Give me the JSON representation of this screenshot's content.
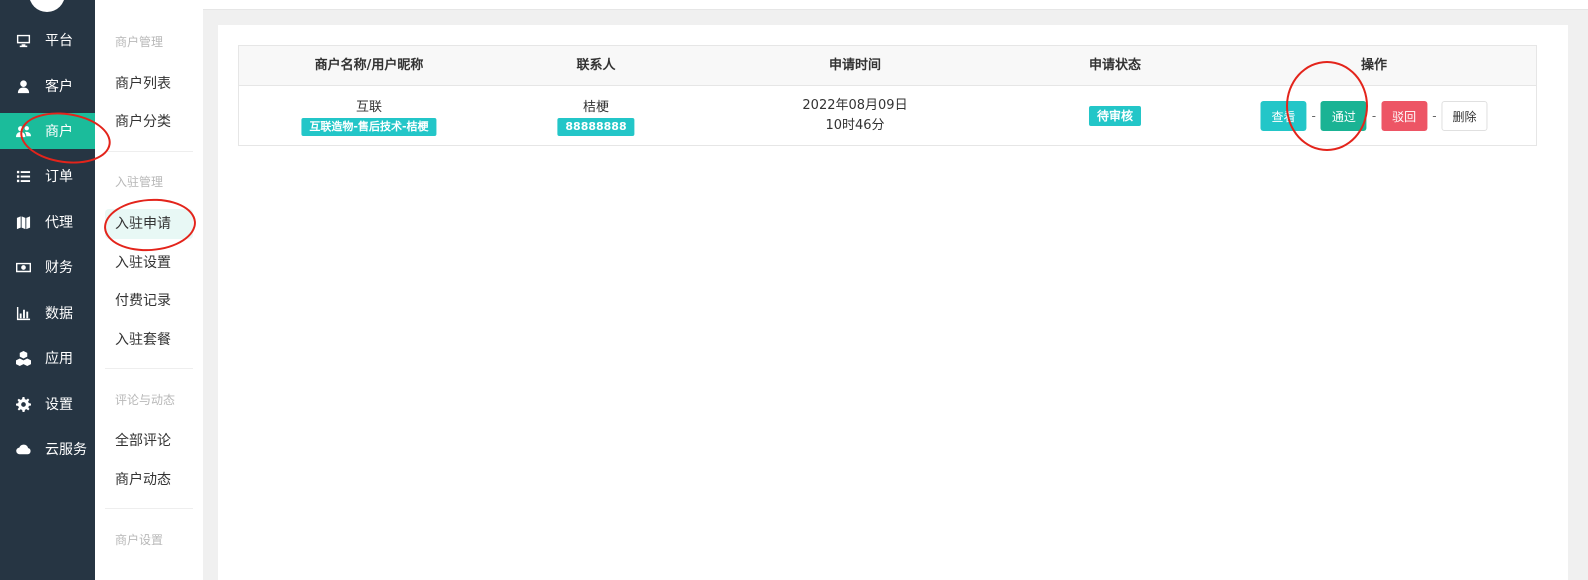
{
  "sidebar": {
    "items": [
      {
        "label": "平台",
        "icon": "monitor-icon"
      },
      {
        "label": "客户",
        "icon": "user-icon"
      },
      {
        "label": "商户",
        "icon": "users-icon",
        "active": true
      },
      {
        "label": "订单",
        "icon": "list-icon"
      },
      {
        "label": "代理",
        "icon": "map-icon"
      },
      {
        "label": "财务",
        "icon": "money-icon"
      },
      {
        "label": "数据",
        "icon": "bar-chart-icon"
      },
      {
        "label": "应用",
        "icon": "cubes-icon"
      },
      {
        "label": "设置",
        "icon": "gear-icon"
      },
      {
        "label": "云服务",
        "icon": "cloud-icon"
      }
    ]
  },
  "subnav": {
    "groups": [
      {
        "title": "商户管理",
        "items": [
          "商户列表",
          "商户分类"
        ]
      },
      {
        "title": "入驻管理",
        "items": [
          "入驻申请",
          "入驻设置",
          "付费记录",
          "入驻套餐"
        ],
        "active": "入驻申请"
      },
      {
        "title": "评论与动态",
        "items": [
          "全部评论",
          "商户动态"
        ]
      },
      {
        "title": "商户设置",
        "items": []
      }
    ]
  },
  "table": {
    "headers": [
      "商户名称/用户昵称",
      "联系人",
      "申请时间",
      "申请状态",
      "操作"
    ],
    "rows": [
      {
        "name": "互联",
        "nickname_tag": "互联造物-售后技术-桔梗",
        "contact": "桔梗",
        "phone_tag": "88888888",
        "date_line1": "2022年08月09日",
        "date_line2": "10时46分",
        "status": "待审核",
        "actions": {
          "view": "查看",
          "pass": "通过",
          "reject": "驳回",
          "delete": "删除",
          "separator": "-"
        }
      }
    ]
  },
  "colors": {
    "sidebar_bg": "#263543",
    "accent": "#1bbc9b",
    "info": "#23c6c8",
    "danger": "#ed5565",
    "annotation": "#e3241b"
  }
}
